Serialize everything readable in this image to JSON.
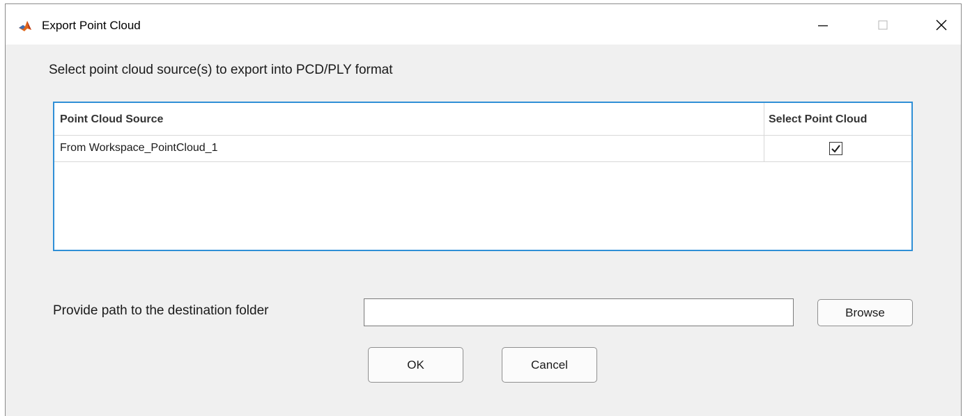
{
  "window": {
    "title": "Export Point Cloud",
    "controls": {
      "minimize": "minimize-icon",
      "maximize": "maximize-icon",
      "close": "close-icon"
    }
  },
  "instruction": "Select point cloud source(s) to export into PCD/PLY format",
  "table": {
    "columns": [
      "Point Cloud Source",
      "Select Point Cloud"
    ],
    "rows": [
      {
        "source": "From Workspace_PointCloud_1",
        "selected": true
      }
    ],
    "border_color": "#2f8fd6"
  },
  "destination": {
    "label": "Provide path to the destination folder",
    "value": "",
    "browse_label": "Browse"
  },
  "buttons": {
    "ok": "OK",
    "cancel": "Cancel"
  }
}
